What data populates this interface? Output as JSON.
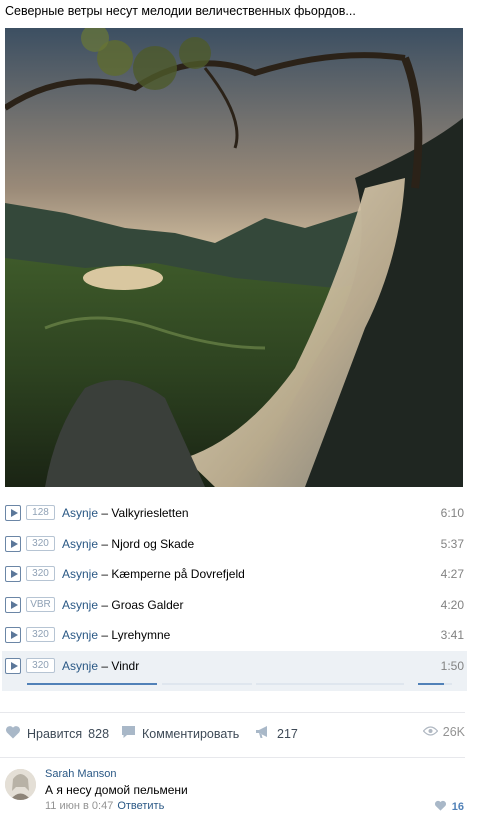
{
  "post": {
    "text": "Северные ветры несут мелодии величественных фьордов..."
  },
  "playlist": {
    "tracks": [
      {
        "quality": "128",
        "artist": "Asynje",
        "title": "Valkyriesletten",
        "duration": "6:10"
      },
      {
        "quality": "320",
        "artist": "Asynje",
        "title": "Njord og Skade",
        "duration": "5:37"
      },
      {
        "quality": "320",
        "artist": "Asynje",
        "title": "Kæmperne på Dovrefjeld",
        "duration": "4:27"
      },
      {
        "quality": "VBR",
        "artist": "Asynje",
        "title": "Groas Galder",
        "duration": "4:20"
      },
      {
        "quality": "320",
        "artist": "Asynje",
        "title": "Lyrehymne",
        "duration": "3:41"
      },
      {
        "quality": "320",
        "artist": "Asynje",
        "title": "Vindr",
        "duration": "1:50",
        "active": true
      }
    ],
    "separator": "–",
    "active_progress_fraction": 0.3,
    "active_volume_fraction": 0.75
  },
  "actions": {
    "like_label": "Нравится",
    "like_count": "828",
    "comment_label": "Комментировать",
    "share_count": "217",
    "views_count": "26K"
  },
  "comment": {
    "author": "Sarah Manson",
    "text": "А я несу домой пельмени",
    "date": "11 июн в 0:47",
    "reply_label": "Ответить",
    "likes": "16"
  },
  "colors": {
    "link": "#2a5885",
    "accent": "#5181b8",
    "muted": "#939393",
    "active_row": "#edf1f5"
  },
  "icons": {
    "play": "play-icon",
    "like": "heart-icon",
    "comment": "comment-icon",
    "share": "megaphone-icon",
    "views": "eye-icon"
  }
}
